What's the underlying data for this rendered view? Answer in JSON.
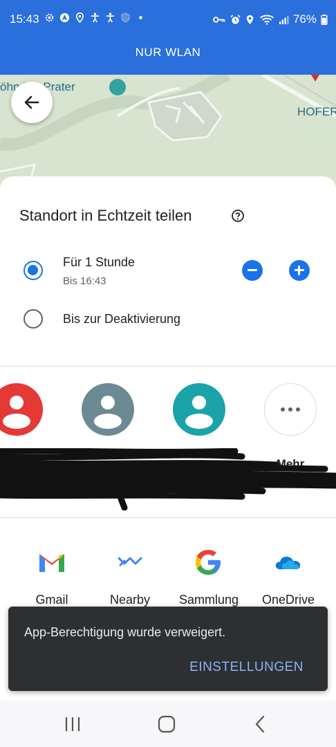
{
  "status_bar": {
    "time": "15:43",
    "battery": "76%"
  },
  "top_bar": {
    "title": "NUR WLAN"
  },
  "map": {
    "place_label": "öhn  her Prater",
    "poi_label": "HOFER"
  },
  "sheet": {
    "title": "Standort in Echtzeit teilen",
    "options": [
      {
        "label": "Für 1 Stunde",
        "sublabel": "Bis 16:43",
        "selected": true
      },
      {
        "label": "Bis zur Deaktivierung",
        "selected": false
      }
    ]
  },
  "contacts": {
    "items": [
      {
        "color": "#e53935"
      },
      {
        "color": "#6b8a93"
      },
      {
        "color": "#1aa3a9"
      }
    ],
    "more_label": "Mehr"
  },
  "apps": [
    {
      "label": "Gmail",
      "icon": "gmail-icon"
    },
    {
      "label": "Nearby",
      "icon": "nearby-icon"
    },
    {
      "label": "Sammlung",
      "icon": "google-icon"
    },
    {
      "label": "OneDrive",
      "icon": "onedrive-icon"
    }
  ],
  "snackbar": {
    "message": "App-Berechtigung wurde verweigert.",
    "action": "EINSTELLUNGEN"
  },
  "colors": {
    "top_bar": "#2a6fdb",
    "accent": "#1a73e8",
    "snackbar_bg": "#2d2f31",
    "snackbar_action": "#8ab4f8"
  }
}
